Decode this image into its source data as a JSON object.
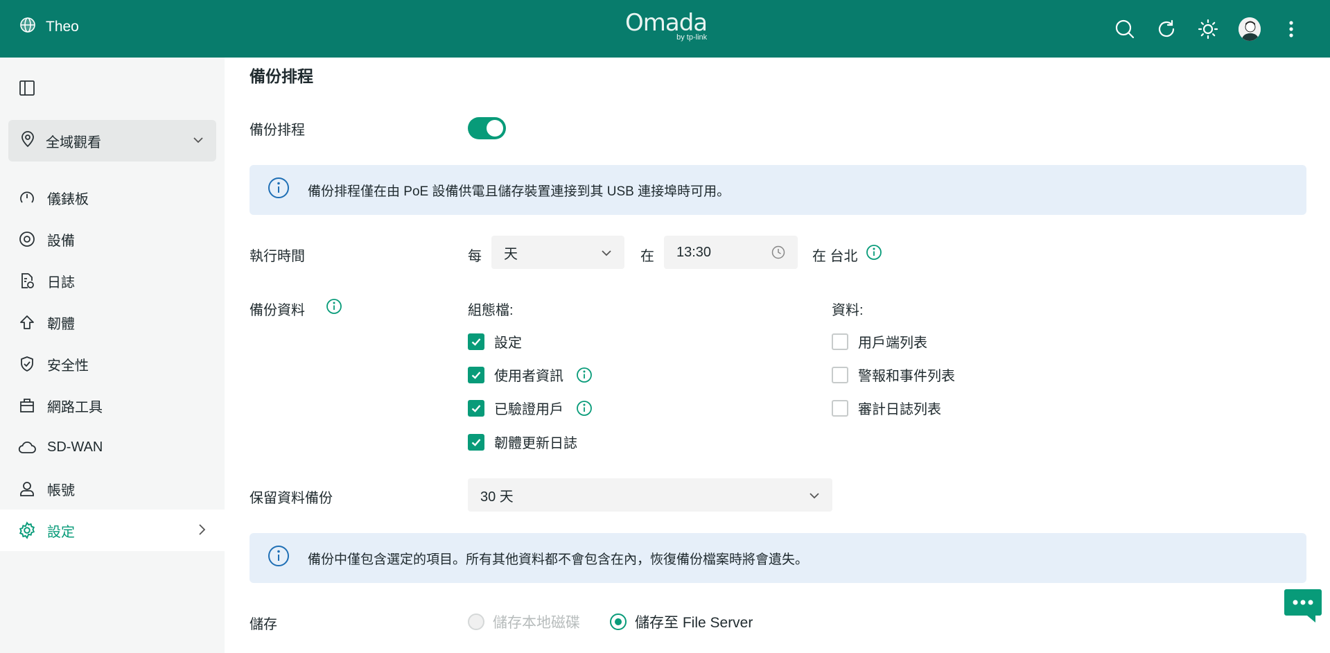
{
  "header": {
    "site_name": "Theo",
    "logo_main": "Omada",
    "logo_sub": "by tp-link"
  },
  "sidebar": {
    "site_selector": "全域觀看",
    "items": [
      {
        "label": "儀錶板"
      },
      {
        "label": "設備"
      },
      {
        "label": "日誌"
      },
      {
        "label": "韌體"
      },
      {
        "label": "安全性"
      },
      {
        "label": "網路工具"
      },
      {
        "label": "SD-WAN"
      },
      {
        "label": "帳號"
      },
      {
        "label": "設定"
      }
    ]
  },
  "main": {
    "section_title": "備份排程",
    "schedule_label": "備份排程",
    "schedule_enabled": true,
    "notice1": "備份排程僅在由 PoE 設備供電且儲存裝置連接到其 USB 連接埠時可用。",
    "run_time": {
      "label": "執行時間",
      "every": "每",
      "frequency": "天",
      "at": "在",
      "time": "13:30",
      "timezone": "在 台北"
    },
    "backup_data": {
      "label": "備份資料",
      "config_header": "組態檔:",
      "data_header": "資料:",
      "config_items": [
        {
          "label": "設定",
          "checked": true
        },
        {
          "label": "使用者資訊",
          "checked": true
        },
        {
          "label": "已驗證用戶",
          "checked": true
        },
        {
          "label": "韌體更新日誌",
          "checked": true
        }
      ],
      "data_items": [
        {
          "label": "用戶端列表",
          "checked": false
        },
        {
          "label": "警報和事件列表",
          "checked": false
        },
        {
          "label": "審計日誌列表",
          "checked": false
        }
      ]
    },
    "retention": {
      "label": "保留資料備份",
      "value": "30 天"
    },
    "notice2": "備份中僅包含選定的項目。所有其他資料都不會包含在內，恢復備份檔案時將會遺失。",
    "storage": {
      "label": "儲存",
      "option_local": "儲存本地磁碟",
      "option_server": "儲存至 File Server",
      "selected": "option_server"
    }
  },
  "colors": {
    "header_bg": "#087c6c",
    "accent": "#089b79",
    "notice_bg": "#e6eff9",
    "info_blue": "#1f6fb5"
  }
}
